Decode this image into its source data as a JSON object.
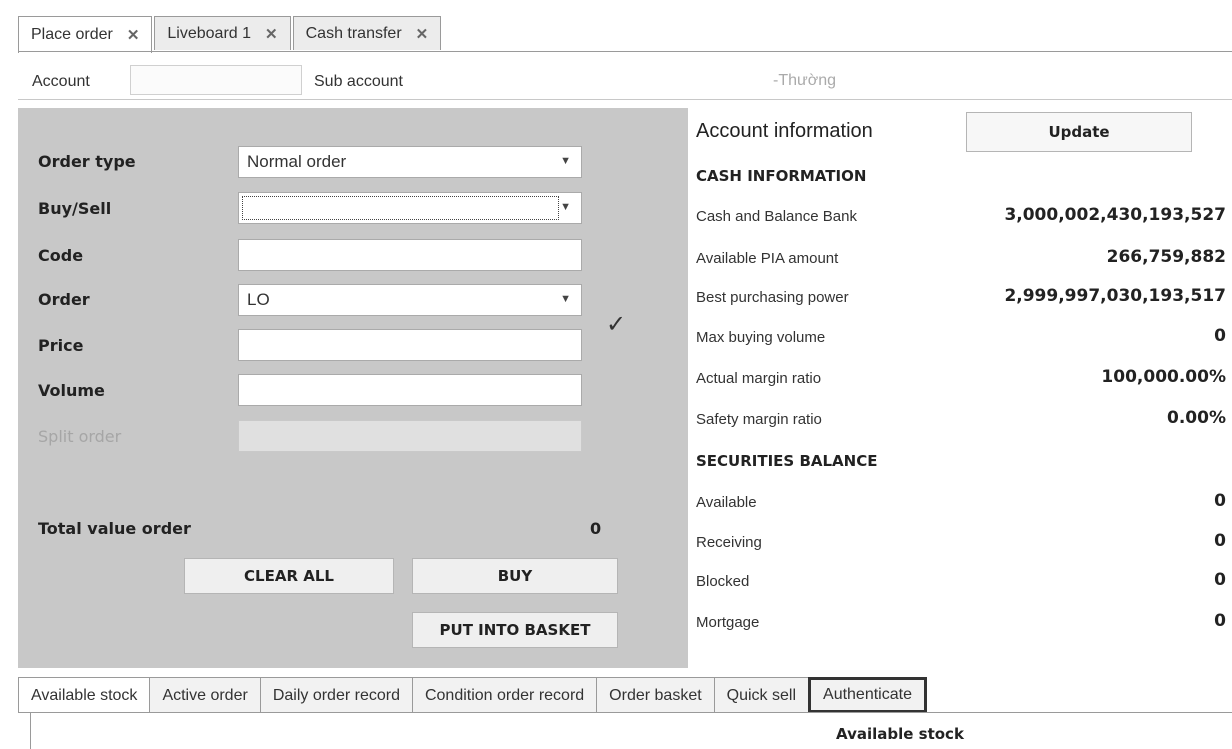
{
  "tabs": [
    {
      "label": "Place order",
      "active": true
    },
    {
      "label": "Liveboard 1",
      "active": false
    },
    {
      "label": "Cash transfer",
      "active": false
    }
  ],
  "account_bar": {
    "account_label": "Account",
    "account_value": "",
    "sub_account_label": "Sub account",
    "sub_account_value": "-Thường"
  },
  "order_form": {
    "order_type_label": "Order type",
    "order_type_value": "Normal order",
    "buy_sell_label": "Buy/Sell",
    "buy_sell_value": "",
    "code_label": "Code",
    "code_value": "",
    "order_label": "Order",
    "order_value": "LO",
    "price_label": "Price",
    "price_value": "",
    "volume_label": "Volume",
    "volume_value": "",
    "split_order_label": "Split order",
    "split_order_checked": "✓",
    "total_label": "Total value order",
    "total_value": "0",
    "clear_all_label": "CLEAR ALL",
    "buy_label": "BUY",
    "put_into_basket_label": "PUT INTO BASKET"
  },
  "account_info": {
    "title": "Account information",
    "update_label": "Update",
    "cash_heading": "CASH INFORMATION",
    "cash_rows": [
      {
        "label": "Cash and Balance Bank",
        "value": "3,000,002,430,193,527"
      },
      {
        "label": "Available PIA amount",
        "value": "266,759,882"
      },
      {
        "label": "Best purchasing power",
        "value": "2,999,997,030,193,517"
      },
      {
        "label": "Max buying volume",
        "value": "0"
      },
      {
        "label": "Actual margin ratio",
        "value": "100,000.00%"
      },
      {
        "label": "Safety margin ratio",
        "value": "0.00%"
      }
    ],
    "securities_heading": "SECURITIES BALANCE",
    "securities_rows": [
      {
        "label": "Available",
        "value": "0"
      },
      {
        "label": "Receiving",
        "value": "0"
      },
      {
        "label": "Blocked",
        "value": "0"
      },
      {
        "label": "Mortgage",
        "value": "0"
      }
    ]
  },
  "bottom_tabs": [
    {
      "label": "Available stock"
    },
    {
      "label": "Active order"
    },
    {
      "label": "Daily order record"
    },
    {
      "label": "Condition order record"
    },
    {
      "label": "Order basket"
    },
    {
      "label": "Quick sell"
    },
    {
      "label": "Authenticate"
    }
  ],
  "available_stock_header": "Available stock"
}
